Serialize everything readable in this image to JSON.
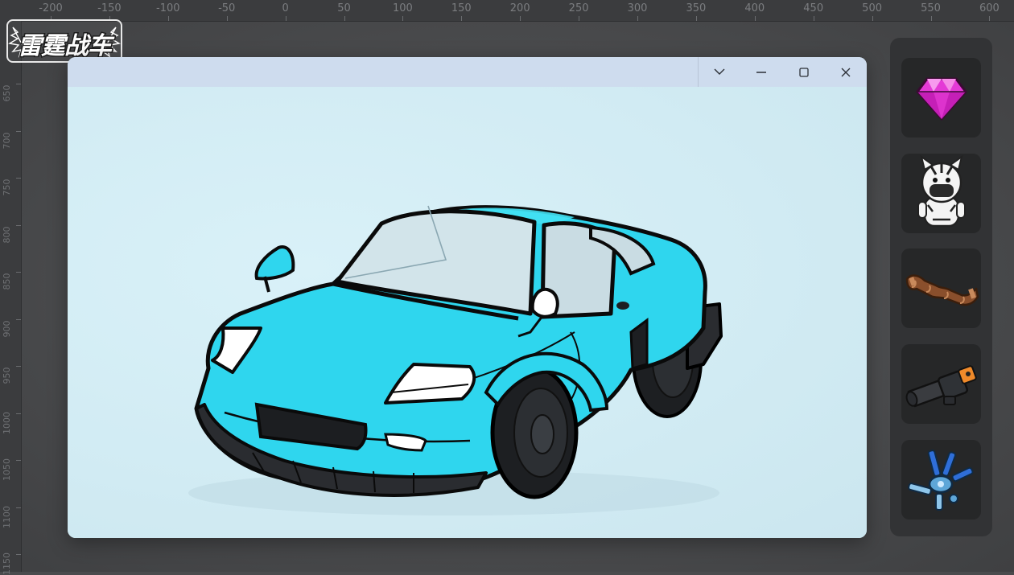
{
  "ruler": {
    "top_labels": [
      "-200",
      "-150",
      "-100",
      "-50",
      "0",
      "50",
      "100",
      "150",
      "200",
      "250",
      "300",
      "350",
      "400",
      "450",
      "500",
      "550",
      "600"
    ],
    "left_labels": [
      "650",
      "700",
      "750",
      "800",
      "850",
      "900",
      "950",
      "1000",
      "1050",
      "1100",
      "1150"
    ]
  },
  "logo": {
    "text": "雷霆战车"
  },
  "window": {
    "controls": [
      {
        "name": "dropdown",
        "icon": "chevron-down-icon"
      },
      {
        "name": "minimize",
        "icon": "minimize-icon"
      },
      {
        "name": "maximize",
        "icon": "maximize-icon"
      },
      {
        "name": "close",
        "icon": "close-icon"
      }
    ],
    "canvas_subject": "sports-car-illustration"
  },
  "colors": {
    "car_body": "#2fd6ee",
    "canvas_bg": "#d4edf5",
    "titlebar": "#cedcee",
    "panel_bg": "#323335",
    "slot_bg": "#262728"
  },
  "item_panel": {
    "items": [
      {
        "id": "gem",
        "icon": "pink-gem-icon"
      },
      {
        "id": "zebra",
        "icon": "zebra-character-icon"
      },
      {
        "id": "wood",
        "icon": "wooden-log-icon"
      },
      {
        "id": "cannon",
        "icon": "cannon-weapon-icon"
      },
      {
        "id": "drone",
        "icon": "blue-drone-icon"
      }
    ]
  }
}
